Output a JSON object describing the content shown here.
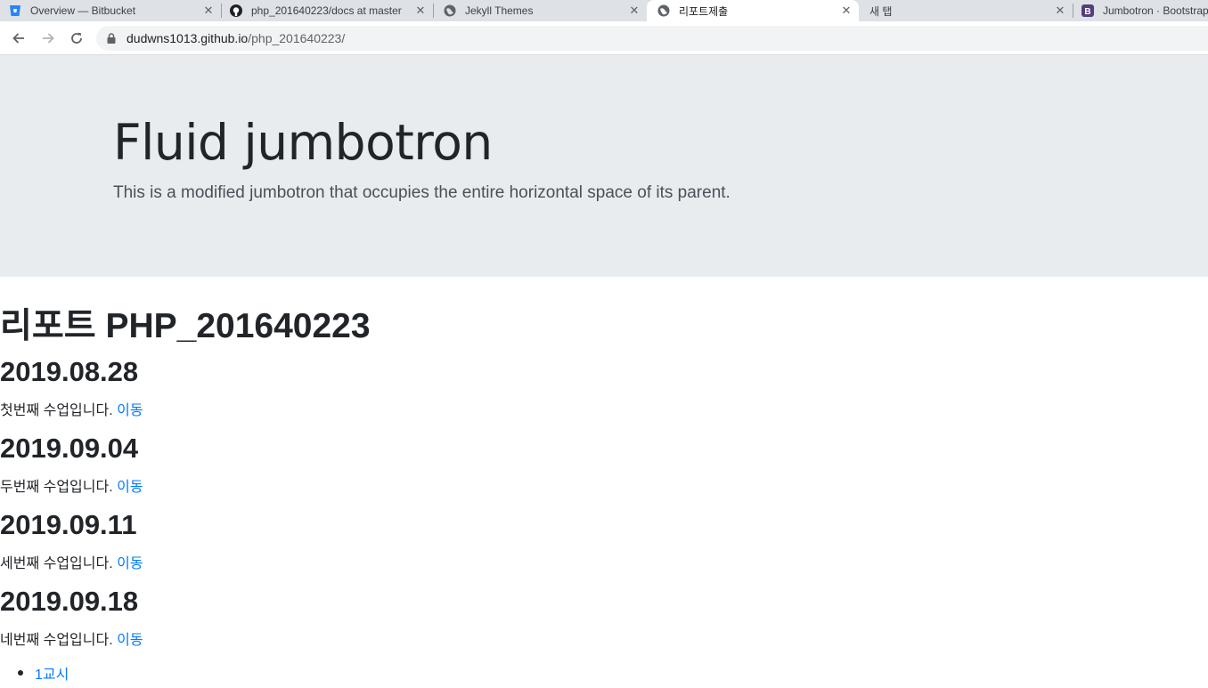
{
  "browser": {
    "tabs": [
      {
        "title": "Overview — Bitbucket",
        "icon": "bitbucket-icon"
      },
      {
        "title": "php_201640223/docs at master",
        "icon": "github-icon"
      },
      {
        "title": "Jekyll Themes",
        "icon": "globe-icon"
      },
      {
        "title": "리포트제출",
        "icon": "globe-icon"
      },
      {
        "title": "새 탭",
        "icon": ""
      },
      {
        "title": "Jumbotron · Bootstrap",
        "icon": "bootstrap-icon"
      }
    ],
    "address": {
      "host": "dudwns1013.github.io",
      "path": "/php_201640223/"
    }
  },
  "jumbotron": {
    "title": "Fluid jumbotron",
    "lead": "This is a modified jumbotron that occupies the entire horizontal space of its parent."
  },
  "main": {
    "heading": "리포트 PHP_201640223",
    "entries": [
      {
        "date": "2019.08.28",
        "text": "첫번째 수업입니다.",
        "link": "이동"
      },
      {
        "date": "2019.09.04",
        "text": "두번째 수업입니다.",
        "link": "이동"
      },
      {
        "date": "2019.09.11",
        "text": "세번째 수업입니다.",
        "link": "이동"
      },
      {
        "date": "2019.09.18",
        "text": "네번째 수업입니다.",
        "link": "이동"
      }
    ],
    "list": [
      "1교시"
    ]
  },
  "colors": {
    "link": "#007bff",
    "jumbotron_bg": "#e9ecef",
    "tabstrip_bg": "#dee1e6"
  }
}
